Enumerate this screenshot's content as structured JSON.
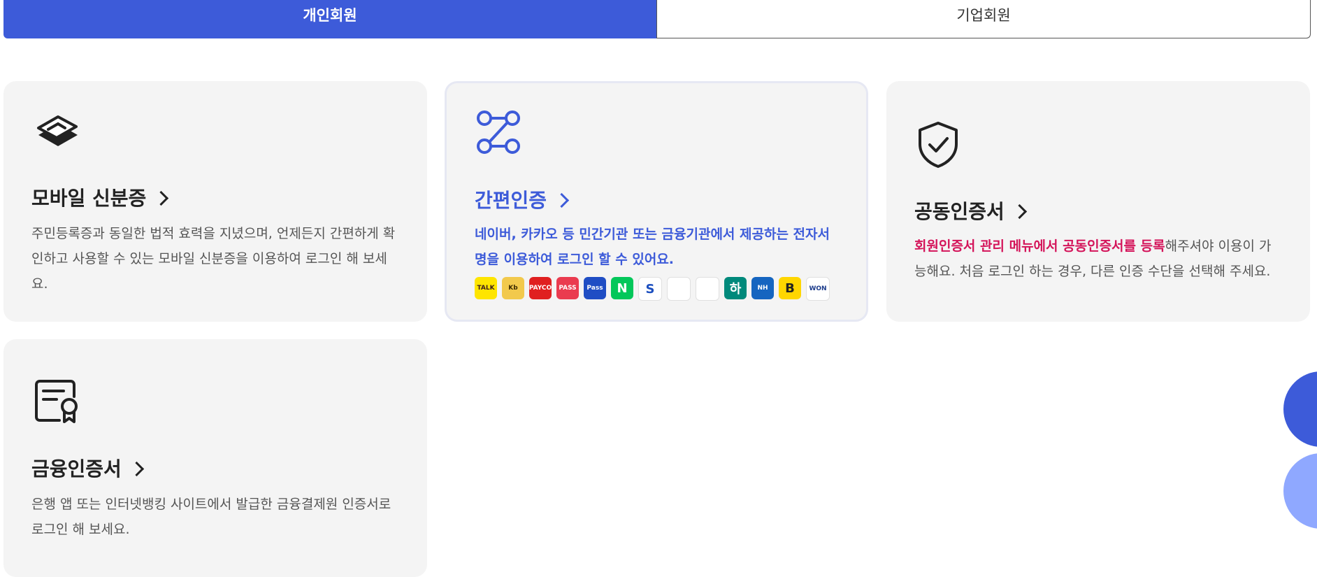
{
  "tabs": {
    "personal": "개인회원",
    "corporate": "기업회원"
  },
  "cards": {
    "mobile_id": {
      "title": "모바일 신분증",
      "desc": "주민등록증과 동일한 법적 효력을 지녔으며, 언제든지 간편하게 확인하고 사용할 수 있는 모바일 신분증을 이용하여 로그인 해 보세요."
    },
    "simple_auth": {
      "title": "간편인증",
      "desc": "네이버, 카카오 등 민간기관 또는 금융기관에서 제공하는 전자서명을 이용하여 로그인 할 수 있어요.",
      "logos": [
        {
          "name": "kakao-talk-logo",
          "text": "TALK",
          "bg": "#fee500",
          "fg": "#3c1e1e"
        },
        {
          "name": "kb-logo",
          "text": "Kb",
          "bg": "#f2c94c",
          "fg": "#3c2a00"
        },
        {
          "name": "payco-logo",
          "text": "PAYCO",
          "bg": "#e02020",
          "fg": "#ffffff"
        },
        {
          "name": "pass-logo",
          "text": "PASS",
          "bg": "#ea3b4f",
          "fg": "#ffffff"
        },
        {
          "name": "samsung-pass-logo",
          "text": "Pass",
          "bg": "#1f4dc4",
          "fg": "#ffffff"
        },
        {
          "name": "naver-logo",
          "text": "N",
          "bg": "#03c75a",
          "fg": "#ffffff"
        },
        {
          "name": "shinhan-logo",
          "text": "S",
          "bg": "#ffffff",
          "fg": "#1c4fbf"
        },
        {
          "name": "toss-logo",
          "text": "",
          "bg": "#ffffff",
          "fg": "#1a73e8"
        },
        {
          "name": "kakaobank-logo",
          "text": "",
          "bg": "#ffffff",
          "fg": "#2bb673"
        },
        {
          "name": "hana-logo",
          "text": "하",
          "bg": "#00897b",
          "fg": "#ffffff"
        },
        {
          "name": "nh-logo",
          "text": "NH",
          "bg": "#1565c0",
          "fg": "#ffffff"
        },
        {
          "name": "banksalad-logo",
          "text": "B",
          "bg": "#ffd600",
          "fg": "#222222"
        },
        {
          "name": "woori-won-logo",
          "text": "WON",
          "bg": "#ffffff",
          "fg": "#1a3a8a"
        }
      ]
    },
    "joint_cert": {
      "title": "공동인증서",
      "desc_highlight": "회원인증서 관리 메뉴에서 공동인증서를 등록",
      "desc_rest": "해주셔야 이용이 가능해요. 처음 로그인 하는 경우, 다른 인증 수단을 선택해 주세요."
    },
    "financial_cert": {
      "title": "금융인증서",
      "desc": "은행 앱 또는 인터넷뱅킹 사이트에서 발급한 금융결제원 인증서로 로그인 해 보세요."
    }
  },
  "colors": {
    "primary": "#3d5bd9",
    "highlight": "#d4145a",
    "card_bg": "#f4f4f4"
  }
}
